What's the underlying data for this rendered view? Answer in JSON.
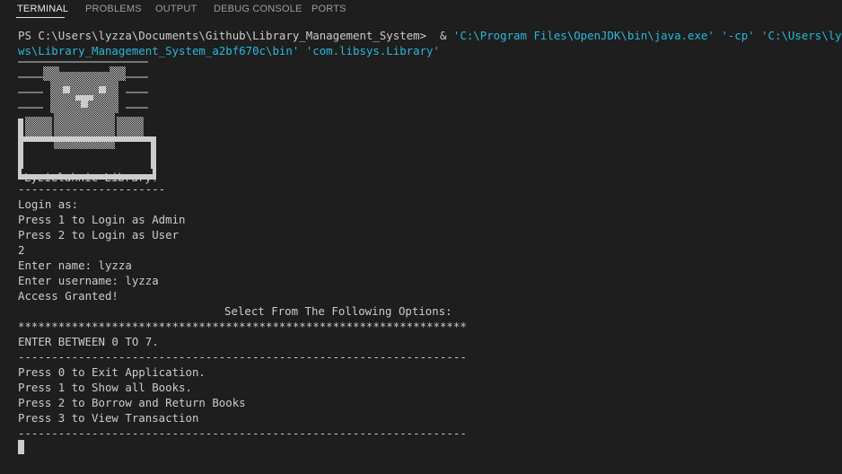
{
  "tabs": [
    {
      "label": "TERMINAL",
      "active": true
    },
    {
      "label": "PROBLEMS",
      "active": false
    },
    {
      "label": "OUTPUT",
      "active": false
    },
    {
      "label": "DEBUG CONSOLE",
      "active": false
    },
    {
      "label": "PORTS",
      "active": false
    }
  ],
  "terminal": {
    "prompt": "PS C:\\Users\\lyzza\\Documents\\Github\\Library_Management_System>",
    "command_amp": "&",
    "command_args": "'C:\\Program Files\\OpenJDK\\bin\\java.exe' '-cp' 'C:\\Users\\lyzza\\AppD",
    "command_args_line2": "ws\\Library_Management_System_a2bf670c\\bin' 'com.libsys.Library'",
    "banner_label": "Lyzielahnic Library!",
    "separator_short": "----------------------",
    "login_as": "Login as:",
    "press_1_admin": "Press 1 to Login as Admin",
    "press_2_user": "Press 2 to Login as User",
    "input_choice": "2",
    "enter_name": "Enter name: lyzza",
    "enter_username": "Enter username: lyzza",
    "access_granted": "Access Granted!",
    "select_options": "Select From The Following Options:",
    "stars": "*******************************************************************",
    "enter_between": "ENTER BETWEEN 0 TO 7.",
    "separator_long_1": "-------------------------------------------------------------------",
    "option_0": "Press 0 to Exit Application.",
    "option_1": "Press 1 to Show all Books.",
    "option_2": "Press 2 to Borrow and Return Books",
    "option_3": "Press 3 to View Transaction",
    "separator_long_2": "-------------------------------------------------------------------"
  },
  "colors": {
    "background": "#1e1e1e",
    "text": "#cccccc",
    "string_cyan": "#29b8db",
    "tab_active": "#e7e7e7",
    "tab_inactive": "#9d9d9d"
  }
}
